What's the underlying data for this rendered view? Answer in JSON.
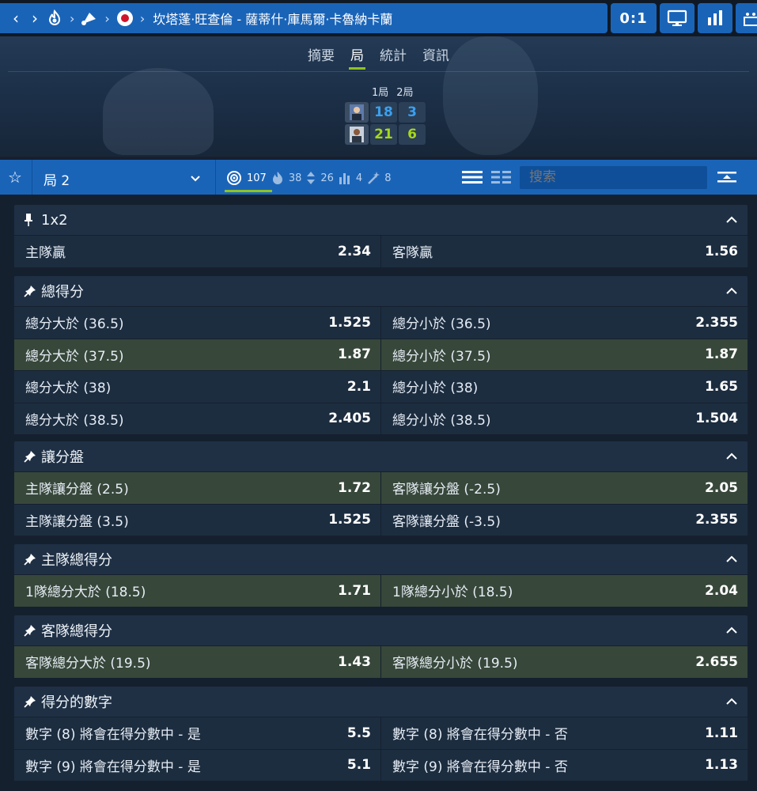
{
  "header": {
    "match_title": "坎塔蓬·旺查倫 - 薩蒂什·庫馬爾·卡魯納卡蘭",
    "score": "0:1",
    "icons": [
      "back-icon",
      "forward-icon",
      "fire-icon",
      "shuttlecock-icon",
      "flag-icon",
      "tv-icon",
      "stats-icon",
      "field-icon"
    ]
  },
  "tabs": [
    "摘要",
    "局",
    "統計",
    "資訊"
  ],
  "active_tab": "局",
  "scoreboard": {
    "set_labels": [
      "1局",
      "2局"
    ],
    "home_scores": [
      "18",
      "3"
    ],
    "away_scores": [
      "21",
      "6"
    ]
  },
  "filter_bar": {
    "selected": "局 2",
    "counts": [
      "107",
      "38",
      "26",
      "4",
      "8"
    ],
    "search_placeholder": "搜索"
  },
  "markets": [
    {
      "title": "1x2",
      "rows": [
        {
          "hl": false,
          "a": [
            "主隊贏",
            "2.34"
          ],
          "b": [
            "客隊贏",
            "1.56"
          ]
        }
      ]
    },
    {
      "title": "總得分",
      "rows": [
        {
          "hl": false,
          "a": [
            "總分大於 (36.5)",
            "1.525"
          ],
          "b": [
            "總分小於 (36.5)",
            "2.355"
          ]
        },
        {
          "hl": true,
          "a": [
            "總分大於 (37.5)",
            "1.87"
          ],
          "b": [
            "總分小於 (37.5)",
            "1.87"
          ]
        },
        {
          "hl": false,
          "a": [
            "總分大於 (38)",
            "2.1"
          ],
          "b": [
            "總分小於 (38)",
            "1.65"
          ]
        },
        {
          "hl": false,
          "a": [
            "總分大於 (38.5)",
            "2.405"
          ],
          "b": [
            "總分小於 (38.5)",
            "1.504"
          ]
        }
      ]
    },
    {
      "title": "讓分盤",
      "rows": [
        {
          "hl": true,
          "a": [
            "主隊讓分盤 (2.5)",
            "1.72"
          ],
          "b": [
            "客隊讓分盤 (-2.5)",
            "2.05"
          ]
        },
        {
          "hl": false,
          "a": [
            "主隊讓分盤 (3.5)",
            "1.525"
          ],
          "b": [
            "客隊讓分盤 (-3.5)",
            "2.355"
          ]
        }
      ]
    },
    {
      "title": "主隊總得分",
      "rows": [
        {
          "hl": true,
          "a": [
            "1隊總分大於 (18.5)",
            "1.71"
          ],
          "b": [
            "1隊總分小於 (18.5)",
            "2.04"
          ]
        }
      ]
    },
    {
      "title": "客隊總得分",
      "rows": [
        {
          "hl": true,
          "a": [
            "客隊總分大於 (19.5)",
            "1.43"
          ],
          "b": [
            "客隊總分小於 (19.5)",
            "2.655"
          ]
        }
      ]
    },
    {
      "title": "得分的數字",
      "rows": [
        {
          "hl": false,
          "a": [
            "數字 (8) 將會在得分數中 - 是",
            "5.5"
          ],
          "b": [
            "數字 (8) 將會在得分數中 - 否",
            "1.11"
          ]
        },
        {
          "hl": false,
          "a": [
            "數字 (9) 將會在得分數中 - 是",
            "5.1"
          ],
          "b": [
            "數字 (9) 將會在得分數中 - 否",
            "1.13"
          ]
        }
      ]
    }
  ]
}
